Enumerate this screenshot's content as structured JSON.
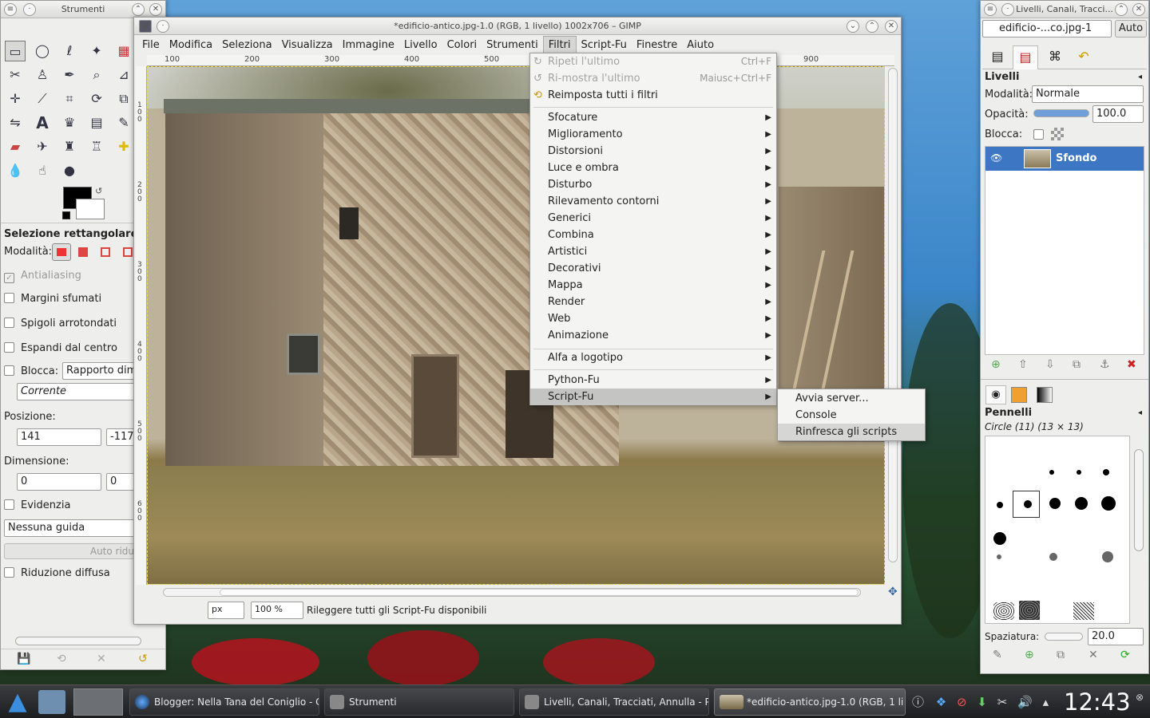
{
  "toolbox": {
    "title": "Strumenti",
    "options_title": "Selezione rettangolare",
    "mode_label": "Modalità:",
    "antialiasing": "Antialiasing",
    "feather": "Margini sfumati",
    "rounded": "Spigoli arrotondati",
    "expand": "Espandi dal centro",
    "lock_label": "Blocca:",
    "lock_value": "Rapporto dime",
    "current": "Corrente",
    "position_label": "Posizione:",
    "pos_x": "141",
    "pos_y": "-117",
    "size_label": "Dimensione:",
    "size_w": "0",
    "size_h": "0",
    "highlight": "Evidenzia",
    "guides": "Nessuna guida",
    "auto_shrink": "Auto riduzione",
    "shrink_merged": "Riduzione diffusa"
  },
  "image_window": {
    "title": "*edificio-antico.jpg-1.0 (RGB, 1 livello) 1002x706 – GIMP",
    "menus": [
      "File",
      "Modifica",
      "Seleziona",
      "Visualizza",
      "Immagine",
      "Livello",
      "Colori",
      "Strumenti",
      "Filtri",
      "Script-Fu",
      "Finestre",
      "Aiuto"
    ],
    "ruler_h": [
      "100",
      "200",
      "300",
      "400",
      "500",
      "900"
    ],
    "ruler_v": [
      "100",
      "200",
      "300",
      "400",
      "500",
      "600"
    ],
    "unit": "px",
    "zoom": "100 %",
    "status": "Rileggere tutti gli Script-Fu disponibili"
  },
  "filters_menu": {
    "repeat_last": "Ripeti l'ultimo",
    "repeat_last_acc": "Ctrl+F",
    "reshow_last": "Ri-mostra l'ultimo",
    "reshow_last_acc": "Maiusc+Ctrl+F",
    "reset_all": "Reimposta tutti i filtri",
    "items": [
      "Sfocature",
      "Miglioramento",
      "Distorsioni",
      "Luce e ombra",
      "Disturbo",
      "Rilevamento contorni",
      "Generici",
      "Combina",
      "Artistici",
      "Decorativi",
      "Mappa",
      "Render",
      "Web",
      "Animazione"
    ],
    "alpha_logo": "Alfa a logotipo",
    "python_fu": "Python-Fu",
    "script_fu": "Script-Fu"
  },
  "scriptfu_submenu": {
    "items": [
      "Avvia server...",
      "Console",
      "Rinfresca gli scripts"
    ]
  },
  "layers_dock": {
    "title": "Livelli, Canali, Tracci...",
    "image_select": "edificio-...co.jpg-1",
    "auto": "Auto",
    "panel_title": "Livelli",
    "mode_label": "Modalità:",
    "mode_value": "Normale",
    "opacity_label": "Opacità:",
    "opacity_value": "100.0",
    "lock_label": "Blocca:",
    "layer_name": "Sfondo",
    "brushes_title": "Pennelli",
    "brush_name": "Circle (11) (13 × 13)",
    "spacing_label": "Spaziatura:",
    "spacing_value": "20.0"
  },
  "taskbar": {
    "tasks": [
      "Blogger: Nella Tana del Coniglio - C",
      "Strumenti",
      "Livelli, Canali, Tracciati, Annulla - P",
      "*edificio-antico.jpg-1.0 (RGB, 1 li"
    ],
    "clock": "12:43"
  }
}
